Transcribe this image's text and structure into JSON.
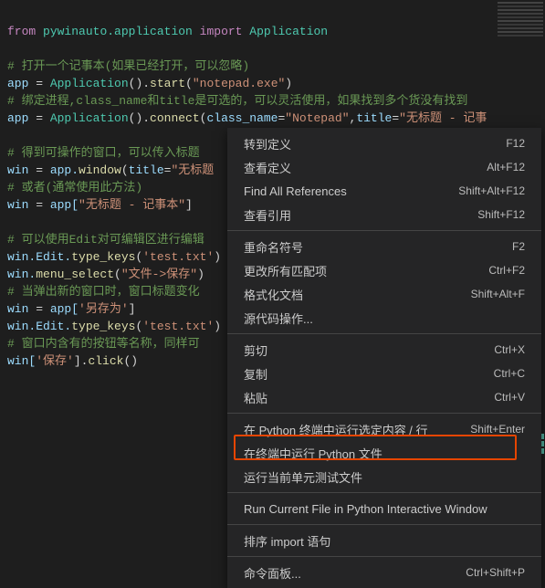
{
  "code": {
    "l1_from": "from",
    "l1_mod": "pywinauto.application",
    "l1_import": "import",
    "l1_app": "Application",
    "l3_cmt": "# 打开一个记事本(如果已经打开，可以忽略)",
    "l4_var": "app",
    "l4_eq": " = ",
    "l4_cls": "Application",
    "l4_p1": "().",
    "l4_fn": "start",
    "l4_p2": "(",
    "l4_str": "\"notepad.exe\"",
    "l4_p3": ")",
    "l5_cmt": "# 绑定进程,class_name和title是可选的，可以灵活使用，如果找到多个货没有找到",
    "l6_var": "app",
    "l6_eq": " = ",
    "l6_cls": "Application",
    "l6_p1": "().",
    "l6_fn": "connect",
    "l6_p2": "(",
    "l6_k1": "class_name",
    "l6_eq2": "=",
    "l6_s1": "\"Notepad\"",
    "l6_c": ",",
    "l6_k2": "title",
    "l6_eq3": "=",
    "l6_s2": "\"无标题 - 记事",
    "l8_cmt": "# 得到可操作的窗口，可以传入标题",
    "l9_var": "win",
    "l9_eq": " = ",
    "l9_app": "app.",
    "l9_fn": "window",
    "l9_p1": "(",
    "l9_k": "title",
    "l9_eq2": "=",
    "l9_s": "\"无标题",
    "l10_cmt": "# 或者(通常使用此方法)",
    "l11_var": "win",
    "l11_eq": " = ",
    "l11_app": "app[",
    "l11_s": "\"无标题 - 记事本\"",
    "l11_p": "]",
    "l13_cmt": "# 可以使用Edit对可编辑区进行编辑",
    "l14_pre": "win.Edit.",
    "l14_fn": "type_keys",
    "l14_p1": "(",
    "l14_s": "'test.txt'",
    "l14_p2": ")",
    "l15_pre": "win.",
    "l15_fn": "menu_select",
    "l15_p1": "(",
    "l15_s": "\"文件->保存\"",
    "l15_p2": ")",
    "l16_cmt": "# 当弹出新的窗口时，窗口标题变化",
    "l17_var": "win",
    "l17_eq": " = ",
    "l17_app": "app[",
    "l17_s": "'另存为'",
    "l17_p": "]",
    "l18_pre": "win.Edit.",
    "l18_fn": "type_keys",
    "l18_p1": "(",
    "l18_s": "'test.txt'",
    "l18_p2": ")",
    "l19_cmt": "# 窗口内含有的按钮等名称，同样可",
    "l20_pre": "win[",
    "l20_s": "'保存'",
    "l20_p": "].",
    "l20_fn": "click",
    "l20_p2": "()"
  },
  "menu": {
    "items": [
      {
        "label": "转到定义",
        "shortcut": "F12"
      },
      {
        "label": "查看定义",
        "shortcut": "Alt+F12"
      },
      {
        "label": "Find All References",
        "shortcut": "Shift+Alt+F12"
      },
      {
        "label": "查看引用",
        "shortcut": "Shift+F12"
      }
    ],
    "items2": [
      {
        "label": "重命名符号",
        "shortcut": "F2"
      },
      {
        "label": "更改所有匹配项",
        "shortcut": "Ctrl+F2"
      },
      {
        "label": "格式化文档",
        "shortcut": "Shift+Alt+F"
      },
      {
        "label": "源代码操作...",
        "shortcut": ""
      }
    ],
    "items3": [
      {
        "label": "剪切",
        "shortcut": "Ctrl+X"
      },
      {
        "label": "复制",
        "shortcut": "Ctrl+C"
      },
      {
        "label": "粘贴",
        "shortcut": "Ctrl+V"
      }
    ],
    "items4": [
      {
        "label": "在 Python 终端中运行选定内容 / 行",
        "shortcut": "Shift+Enter"
      },
      {
        "label": "在终端中运行 Python 文件",
        "shortcut": ""
      },
      {
        "label": "运行当前单元测试文件",
        "shortcut": ""
      }
    ],
    "items5": [
      {
        "label": "Run Current File in Python Interactive Window",
        "shortcut": ""
      }
    ],
    "items6": [
      {
        "label": "排序 import 语句",
        "shortcut": ""
      }
    ],
    "items7": [
      {
        "label": "命令面板...",
        "shortcut": "Ctrl+Shift+P"
      }
    ]
  }
}
